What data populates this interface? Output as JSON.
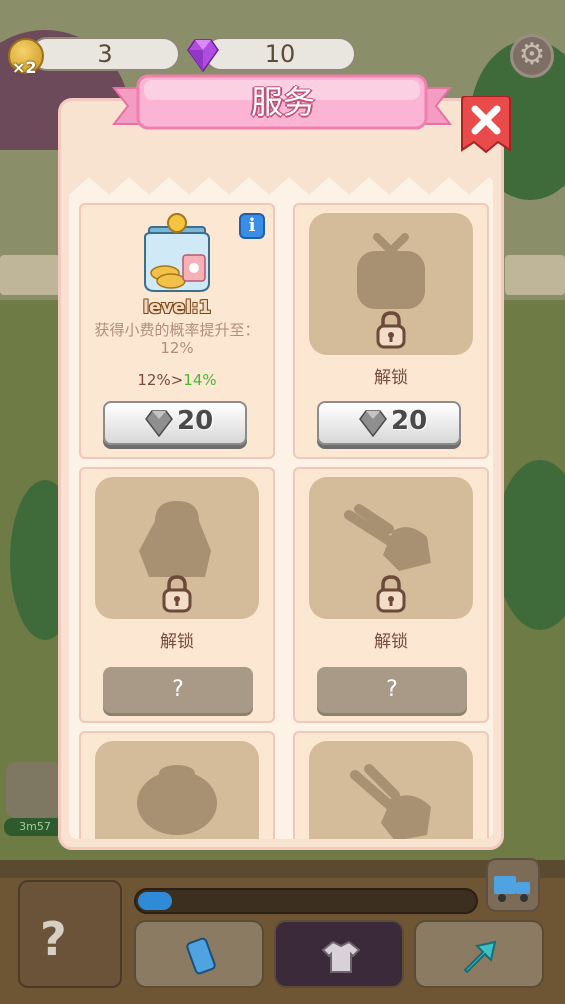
{
  "hud": {
    "coins": "3",
    "coin_multiplier": "×2",
    "gems": "10"
  },
  "modal": {
    "title": "服务",
    "close_icon": "close-x-icon"
  },
  "cards": [
    {
      "level": "level:1",
      "description": "获得小费的概率提升至：12%",
      "rate_current": "12%",
      "rate_arrow": ">",
      "rate_next": "14%",
      "cost": "20"
    },
    {
      "label": "解锁",
      "cost": "20"
    },
    {
      "label": "解锁",
      "button": "?"
    },
    {
      "label": "解锁",
      "button": "?"
    }
  ],
  "bottom_bar": {
    "progress": 0.1,
    "shed_label": "?"
  },
  "side": {
    "timer": "3m57"
  },
  "colors": {
    "accent_pink": "#f7a8c8",
    "close_red": "#e94b4b",
    "gem_purple": "#b04ce0",
    "rate_green": "#4db636"
  }
}
